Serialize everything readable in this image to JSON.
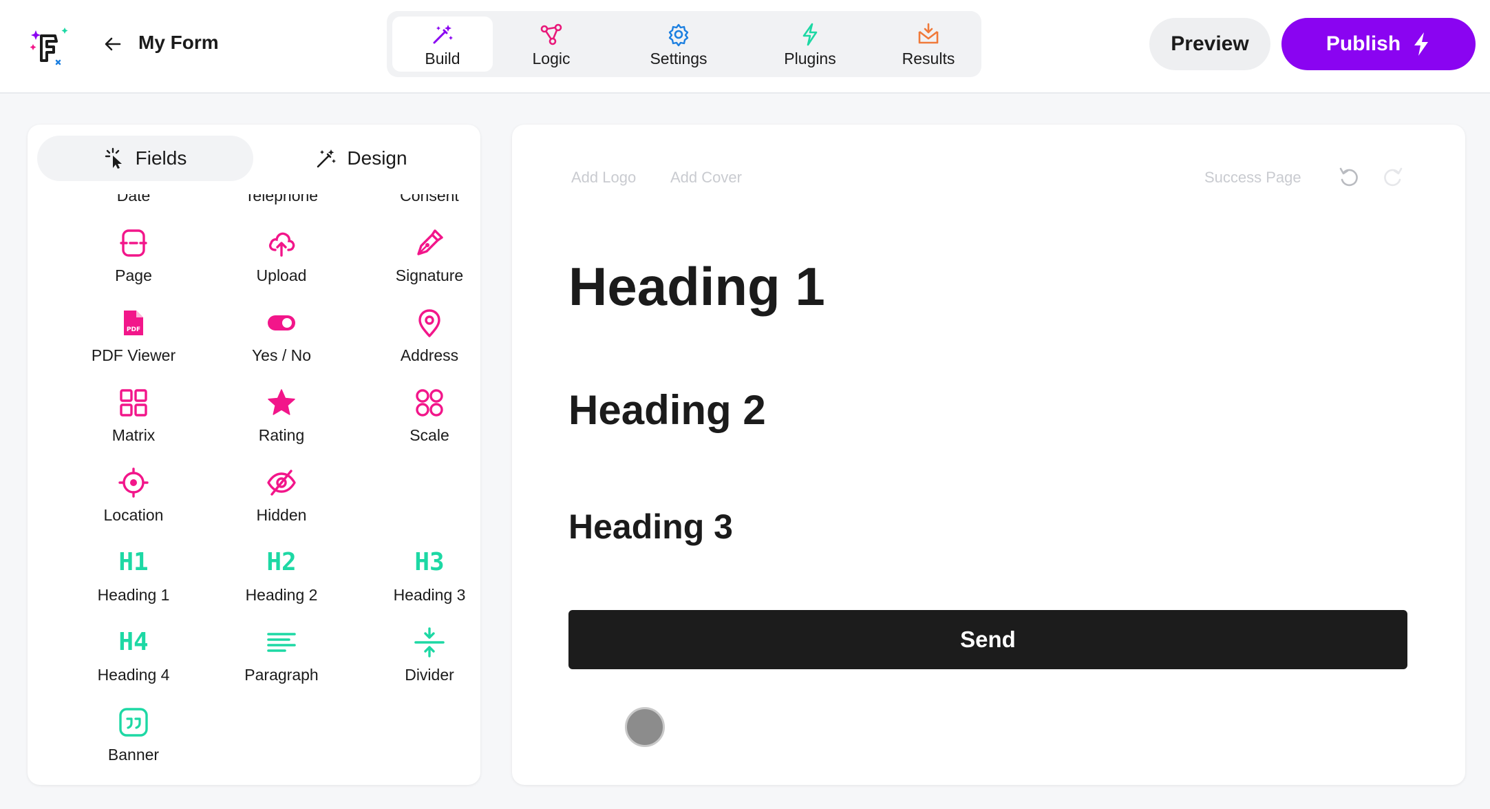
{
  "header": {
    "form_title": "My Form",
    "tabs": [
      {
        "label": "Build",
        "icon": "magic-wand-icon",
        "color": "#8a04f1"
      },
      {
        "label": "Logic",
        "icon": "nodes-icon",
        "color": "#e8197a"
      },
      {
        "label": "Settings",
        "icon": "gear-icon",
        "color": "#1b7fe0"
      },
      {
        "label": "Plugins",
        "icon": "bolt-icon",
        "color": "#1dd8a4"
      },
      {
        "label": "Results",
        "icon": "inbox-icon",
        "color": "#f07a3a"
      }
    ],
    "preview_label": "Preview",
    "publish_label": "Publish"
  },
  "left_panel": {
    "tabs": [
      {
        "label": "Fields",
        "icon": "pointer-click-icon"
      },
      {
        "label": "Design",
        "icon": "magic-wand-icon"
      }
    ],
    "cut_off_labels": [
      "Date",
      "Telephone",
      "Consent"
    ],
    "fields": [
      {
        "label": "Page",
        "icon": "page-icon"
      },
      {
        "label": "Upload",
        "icon": "cloud-upload-icon"
      },
      {
        "label": "Signature",
        "icon": "pen-icon"
      },
      {
        "label": "PDF Viewer",
        "icon": "pdf-icon"
      },
      {
        "label": "Yes / No",
        "icon": "toggle-icon"
      },
      {
        "label": "Address",
        "icon": "map-pin-icon"
      },
      {
        "label": "Matrix",
        "icon": "grid-icon"
      },
      {
        "label": "Rating",
        "icon": "star-icon"
      },
      {
        "label": "Scale",
        "icon": "four-dots-icon"
      },
      {
        "label": "Location",
        "icon": "target-icon"
      },
      {
        "label": "Hidden",
        "icon": "eye-off-icon"
      },
      {
        "label": "Heading 1",
        "icon_text": "H1"
      },
      {
        "label": "Heading 2",
        "icon_text": "H2"
      },
      {
        "label": "Heading 3",
        "icon_text": "H3"
      },
      {
        "label": "Heading 4",
        "icon_text": "H4"
      },
      {
        "label": "Paragraph",
        "icon": "paragraph-icon"
      },
      {
        "label": "Divider",
        "icon": "divider-icon"
      },
      {
        "label": "Banner",
        "icon": "quote-icon"
      }
    ],
    "pink_color": "#f2168a",
    "teal_color": "#1dd8a4"
  },
  "canvas": {
    "add_logo": "Add Logo",
    "add_cover": "Add Cover",
    "success_page": "Success Page",
    "heading1": "Heading 1",
    "heading2": "Heading 2",
    "heading3": "Heading 3",
    "send_label": "Send"
  }
}
